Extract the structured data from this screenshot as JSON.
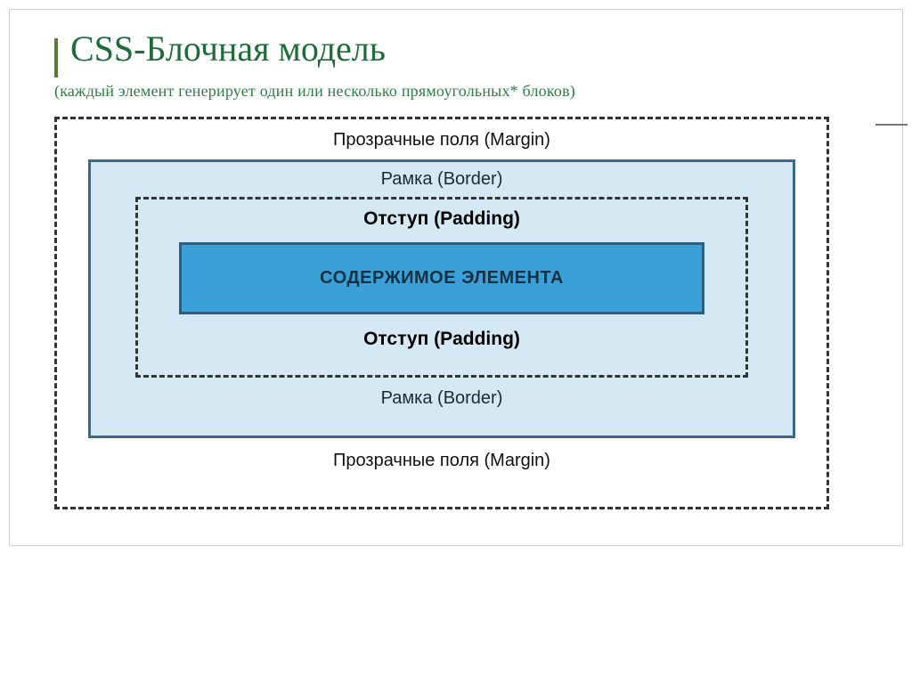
{
  "slide": {
    "title": "CSS-Блочная модель",
    "subtitle": "(каждый элемент генерирует один или несколько прямоугольных* блоков)"
  },
  "diagram": {
    "margin_top": "Прозрачные поля (Margin)",
    "margin_bottom": "Прозрачные поля (Margin)",
    "border_top": "Рамка (Border)",
    "border_bottom": "Рамка (Border)",
    "padding_top": "Отступ (Padding)",
    "padding_bottom": "Отступ (Padding)",
    "content": "СОДЕРЖИМОЕ ЭЛЕМЕНТА"
  }
}
